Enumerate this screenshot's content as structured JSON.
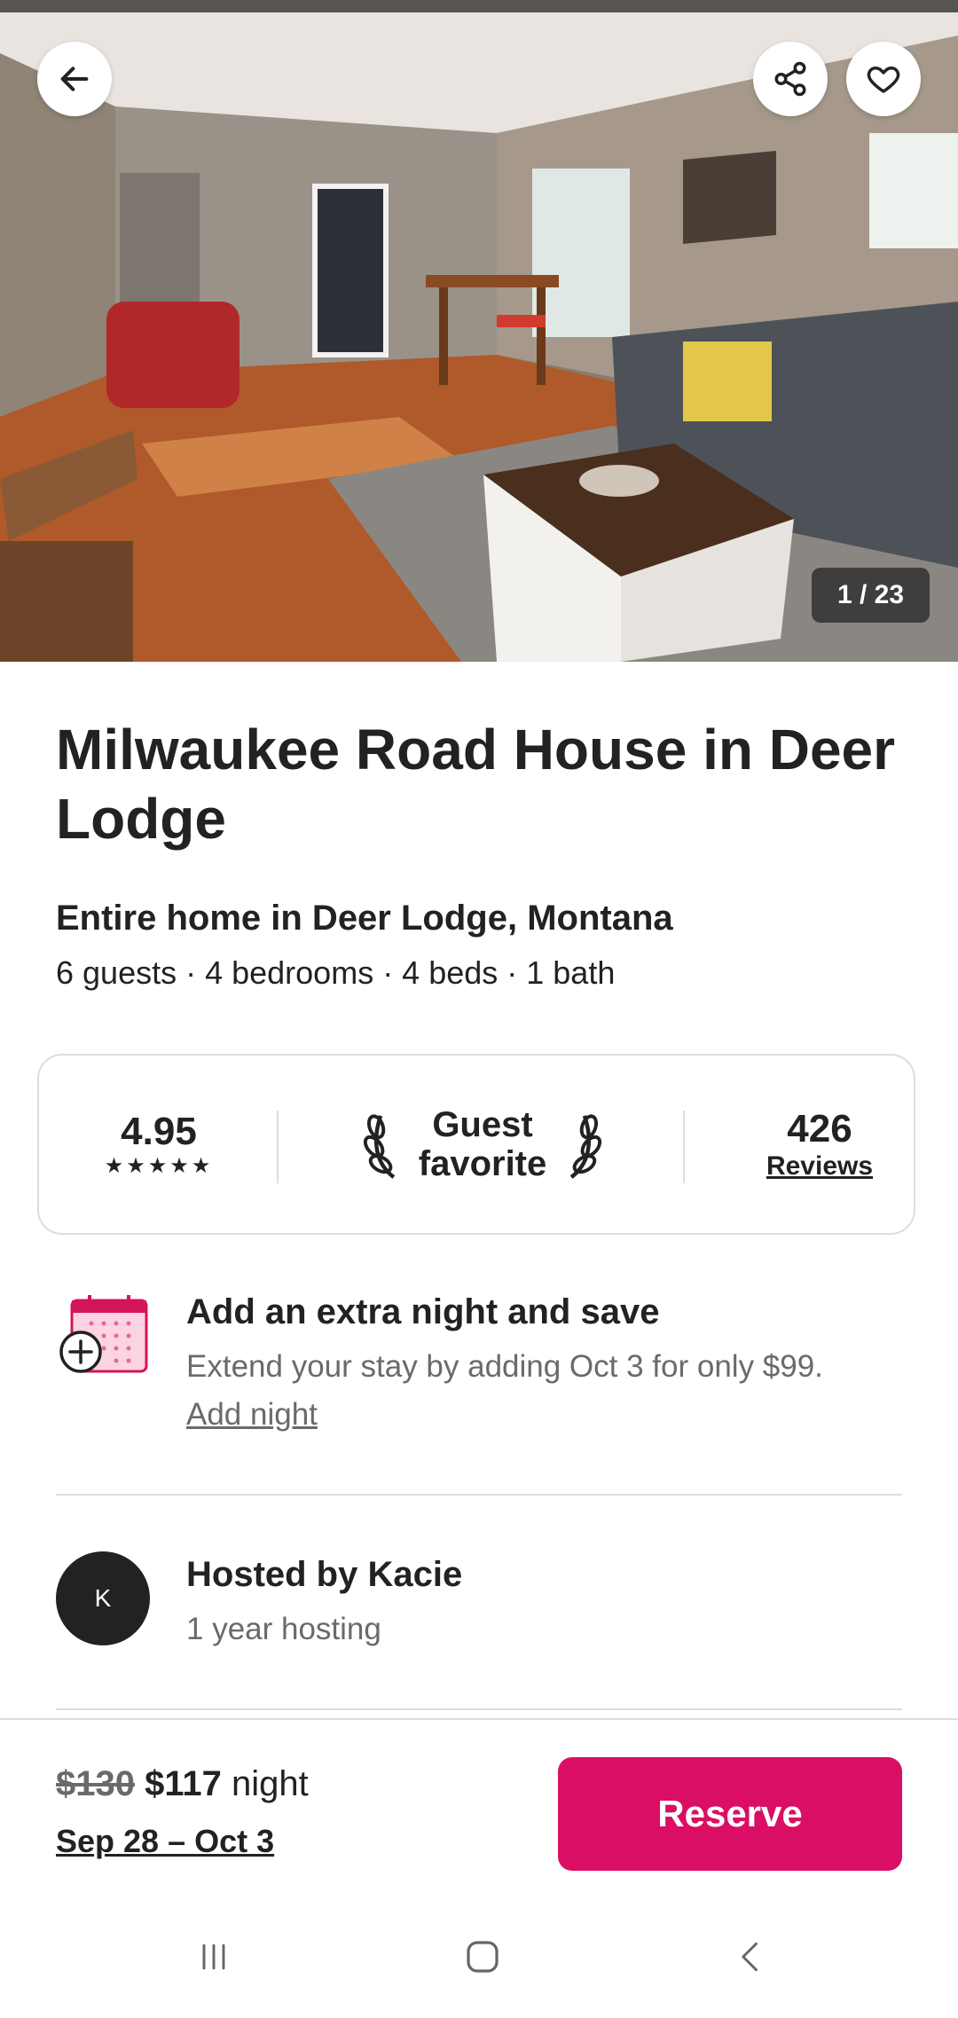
{
  "photo": {
    "counter": "1 / 23",
    "back_icon": "arrow-left-icon",
    "share_icon": "share-icon",
    "favorite_icon": "heart-icon"
  },
  "listing": {
    "title": "Milwaukee Road House in Deer Lodge",
    "subtitle": "Entire home in Deer Lodge, Montana",
    "details": "6 guests · 4 bedrooms · 4 beds · 1 bath"
  },
  "rating_card": {
    "rating": "4.95",
    "stars": "★★★★★",
    "badge_label": "Guest favorite",
    "reviews_count": "426",
    "reviews_label": "Reviews"
  },
  "extra_night": {
    "title": "Add an extra night and save",
    "description": "Extend your stay by adding Oct 3 for only $99.",
    "link": "Add night"
  },
  "host": {
    "initial": "K",
    "name": "Hosted by Kacie",
    "since": "1 year hosting"
  },
  "booking": {
    "old_price": "$130",
    "new_price": "$117",
    "unit": "night",
    "dates": "Sep 28 – Oct 3",
    "reserve_label": "Reserve"
  },
  "colors": {
    "accent": "#da0e64",
    "text": "#222222",
    "muted": "#6a6a6a",
    "border": "#dddddd"
  }
}
